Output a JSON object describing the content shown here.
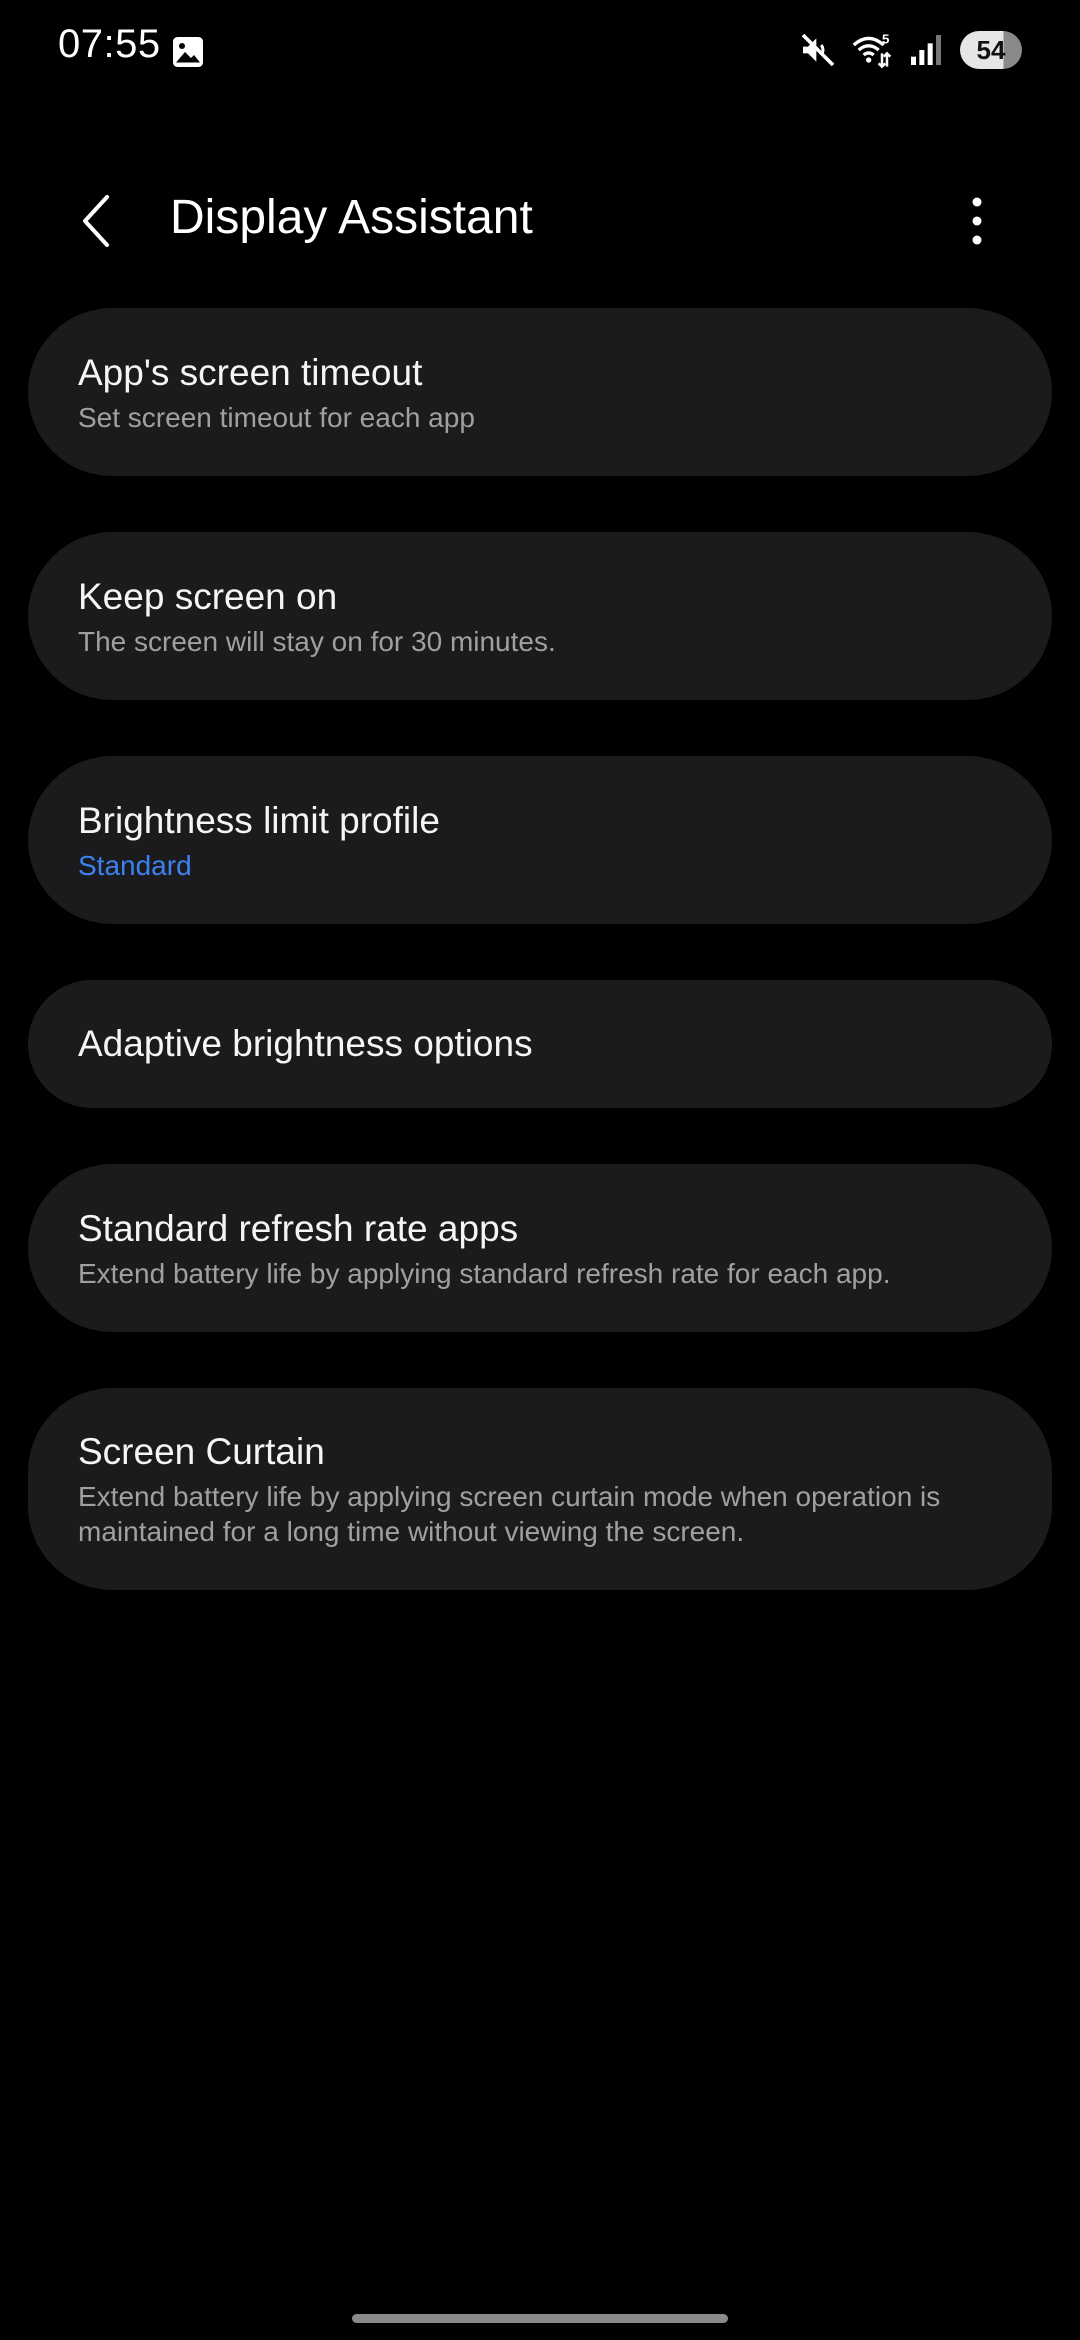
{
  "status_bar": {
    "time": "07:55",
    "battery_level": "54",
    "icons": [
      "gallery-icon",
      "mute-icon",
      "wifi-icon",
      "signal-icon",
      "battery-icon"
    ],
    "wifi_badge": "5"
  },
  "header": {
    "title": "Display Assistant",
    "back_icon": "chevron-left-icon",
    "more_icon": "more-vertical-icon"
  },
  "settings": {
    "items": [
      {
        "title": "App's screen timeout",
        "subtitle": "Set screen timeout for each app"
      },
      {
        "title": "Keep screen on",
        "subtitle": "The screen will stay on for 30 minutes."
      },
      {
        "title": "Brightness limit profile",
        "subtitle": "Standard"
      },
      {
        "title": "Adaptive brightness options"
      },
      {
        "title": "Standard refresh rate apps",
        "subtitle": "Extend battery life by applying standard refresh rate for each app."
      },
      {
        "title": "Screen Curtain",
        "subtitle_line1": "Extend battery life by applying screen curtain mode when operation is",
        "subtitle_line2": "maintained for a long time without viewing the screen."
      }
    ]
  },
  "colors": {
    "background": "#000000",
    "card": "#1b1b1d",
    "accent": "#3b82f0",
    "text_primary": "#f5f5f5",
    "text_secondary": "#a0a0a0"
  }
}
